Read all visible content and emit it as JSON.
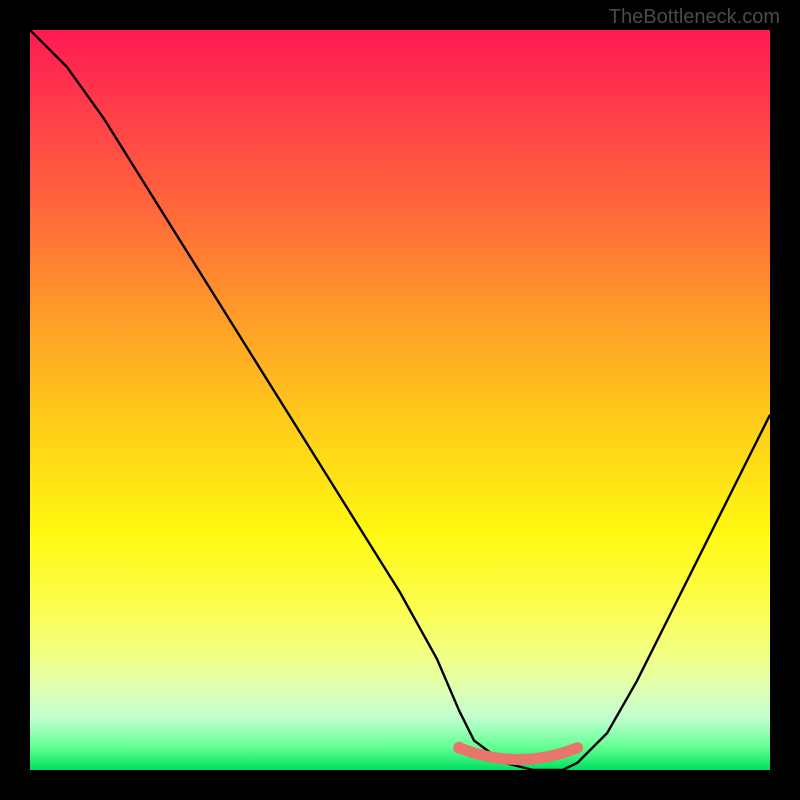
{
  "attribution": "TheBottleneck.com",
  "chart_data": {
    "type": "line",
    "title": "",
    "xlabel": "",
    "ylabel": "",
    "xlim": [
      0,
      100
    ],
    "ylim": [
      0,
      100
    ],
    "series": [
      {
        "name": "bottleneck-curve",
        "color": "#000000",
        "x": [
          0,
          5,
          10,
          15,
          20,
          25,
          30,
          35,
          40,
          45,
          50,
          55,
          58,
          60,
          64,
          68,
          72,
          74,
          78,
          82,
          86,
          90,
          94,
          98,
          100
        ],
        "y": [
          100,
          95,
          88,
          80,
          72,
          64,
          56,
          48,
          40,
          32,
          24,
          15,
          8,
          4,
          1,
          0,
          0,
          1,
          5,
          12,
          20,
          28,
          36,
          44,
          48
        ]
      },
      {
        "name": "optimal-plateau",
        "color": "#e8746c",
        "x": [
          58,
          60,
          62,
          64,
          66,
          68,
          70,
          72,
          74
        ],
        "y": [
          3.0,
          2.3,
          1.8,
          1.5,
          1.4,
          1.5,
          1.8,
          2.3,
          3.0
        ]
      }
    ],
    "markers": [
      {
        "name": "optimal-start-dot",
        "x": 58,
        "y": 3.0,
        "color": "#e8746c"
      }
    ],
    "background_gradient": {
      "top": "#ff1a53",
      "bottom": "#00e060"
    }
  }
}
